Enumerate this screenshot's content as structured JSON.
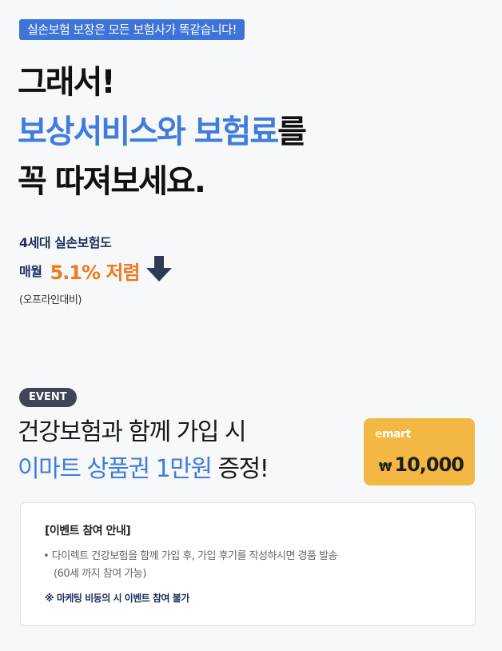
{
  "badge": "실손보험 보장은 모든 보험사가 똑같습니다!",
  "headline": {
    "line1": "그래서!",
    "line2_blue": "보상서비스와 보험료",
    "line2_black": "를",
    "line3": "꼭 따져보세요."
  },
  "stat": {
    "line1": "4세대 실손보험도",
    "monthly": "매월",
    "percent": "5.1% 저렴",
    "note": "(오프라인대비)",
    "arrow_icon": "arrow-down-icon"
  },
  "event": {
    "pill": "EVENT",
    "title_line1": "건강보험과 함께 가입 시",
    "title_line2_blue": "이마트 상품권 1만원",
    "title_line2_black": " 증정!"
  },
  "giftcard": {
    "logo_e": "e",
    "logo_rest": "mart",
    "currency": "₩",
    "amount": "10,000"
  },
  "notice": {
    "title": "[이벤트 참여 안내]",
    "bullet_line1": "• 다이렉트 건강보험을 함께 가입 후, 가입 후기를 작성하시면 경품 발송",
    "bullet_line2": "(60세 까지 참여 가능)",
    "warning": "※ 마케팅 비동의 시 이벤트 참여 불가"
  },
  "colors": {
    "blue": "#3f7cdb",
    "orange": "#ef7a20",
    "navy": "#1d2f5f",
    "giftcard": "#f3b843"
  }
}
